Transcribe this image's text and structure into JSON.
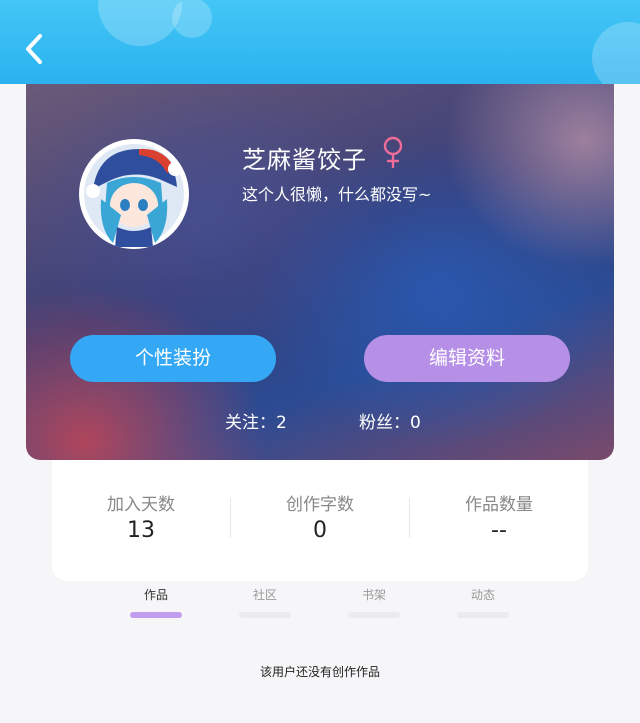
{
  "profile": {
    "username": "芝麻酱饺子",
    "bio": "这个人很懒，什么都没写~",
    "decor_button_label": "个性装扮",
    "edit_button_label": "编辑资料",
    "following_text": "关注：2",
    "fans_text": "粉丝：0",
    "accent_blue": "#35a8f5",
    "accent_purple": "#b68fe6",
    "gender_icon": "female-symbol-icon"
  },
  "stats": [
    {
      "label": "加入天数",
      "value": "13"
    },
    {
      "label": "创作字数",
      "value": "0"
    },
    {
      "label": "作品数量",
      "value": "--"
    }
  ],
  "tabs": [
    {
      "label": "作品",
      "active": true
    },
    {
      "label": "社区",
      "active": false
    },
    {
      "label": "书架",
      "active": false
    },
    {
      "label": "动态",
      "active": false
    }
  ],
  "empty_state": "该用户还没有创作作品"
}
